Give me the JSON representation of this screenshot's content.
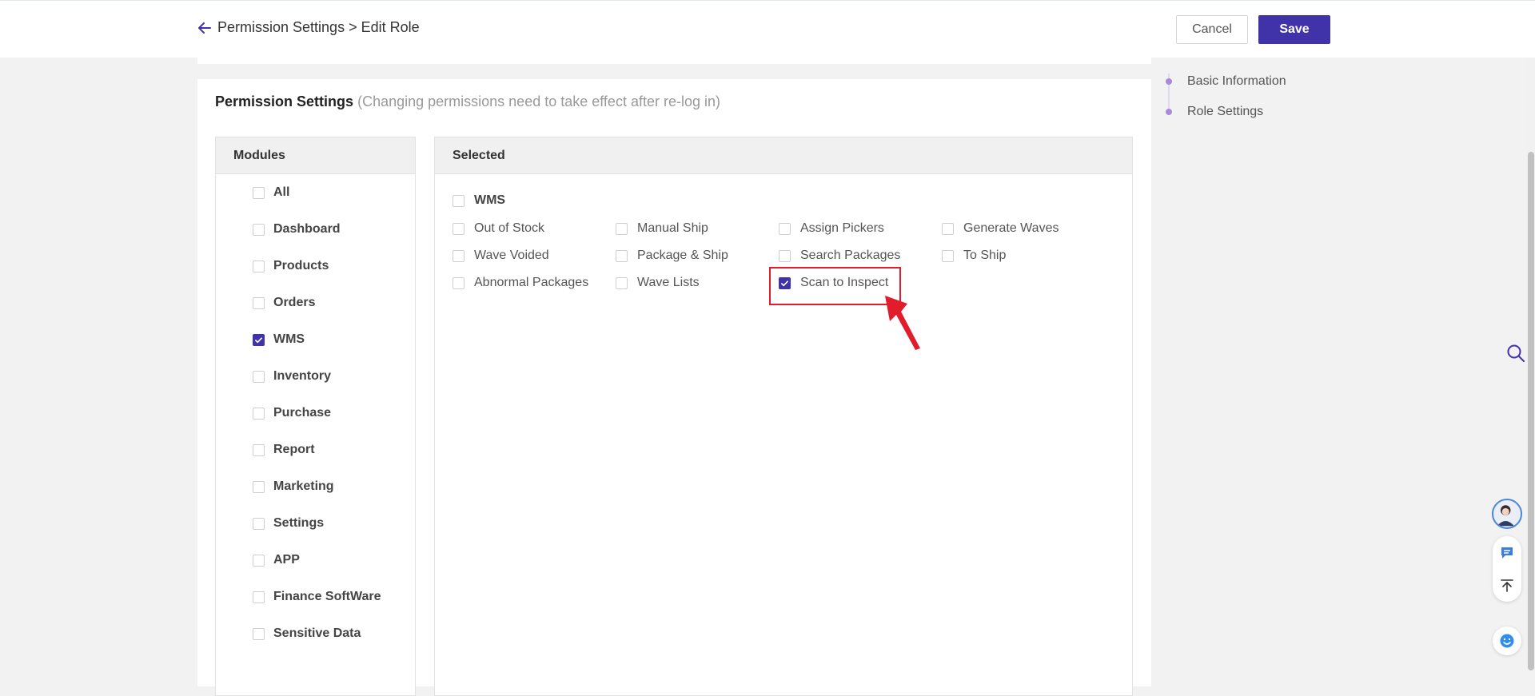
{
  "header": {
    "breadcrumb": "Permission Settings > Edit Role",
    "cancel_label": "Cancel",
    "save_label": "Save"
  },
  "section": {
    "title": "Permission Settings",
    "note": "(Changing permissions need to take effect after re-log in)"
  },
  "modules": {
    "header": "Modules",
    "items": [
      {
        "label": "All",
        "checked": false
      },
      {
        "label": "Dashboard",
        "checked": false
      },
      {
        "label": "Products",
        "checked": false
      },
      {
        "label": "Orders",
        "checked": false
      },
      {
        "label": "WMS",
        "checked": true
      },
      {
        "label": "Inventory",
        "checked": false
      },
      {
        "label": "Purchase",
        "checked": false
      },
      {
        "label": "Report",
        "checked": false
      },
      {
        "label": "Marketing",
        "checked": false
      },
      {
        "label": "Settings",
        "checked": false
      },
      {
        "label": "APP",
        "checked": false
      },
      {
        "label": "Finance SoftWare",
        "checked": false
      },
      {
        "label": "Sensitive Data",
        "checked": false
      }
    ]
  },
  "selected": {
    "header": "Selected",
    "group_label": "WMS",
    "group_checked": false,
    "permissions": [
      {
        "label": "Out of Stock",
        "checked": false
      },
      {
        "label": "Manual Ship",
        "checked": false
      },
      {
        "label": "Assign Pickers",
        "checked": false
      },
      {
        "label": "Generate Waves",
        "checked": false
      },
      {
        "label": "Wave Voided",
        "checked": false
      },
      {
        "label": "Package & Ship",
        "checked": false
      },
      {
        "label": "Search Packages",
        "checked": false
      },
      {
        "label": "To Ship",
        "checked": false
      },
      {
        "label": "Abnormal Packages",
        "checked": false
      },
      {
        "label": "Wave Lists",
        "checked": false
      },
      {
        "label": "Scan to Inspect",
        "checked": true
      }
    ]
  },
  "anchor_nav": {
    "items": [
      "Basic Information",
      "Role Settings"
    ]
  },
  "colors": {
    "accent": "#4032a9",
    "highlight": "#e11d2b"
  },
  "icons": {
    "back": "arrow-left-icon",
    "search": "search-icon",
    "chat": "chat-icon",
    "top": "back-to-top-icon",
    "help": "help-face-icon"
  }
}
